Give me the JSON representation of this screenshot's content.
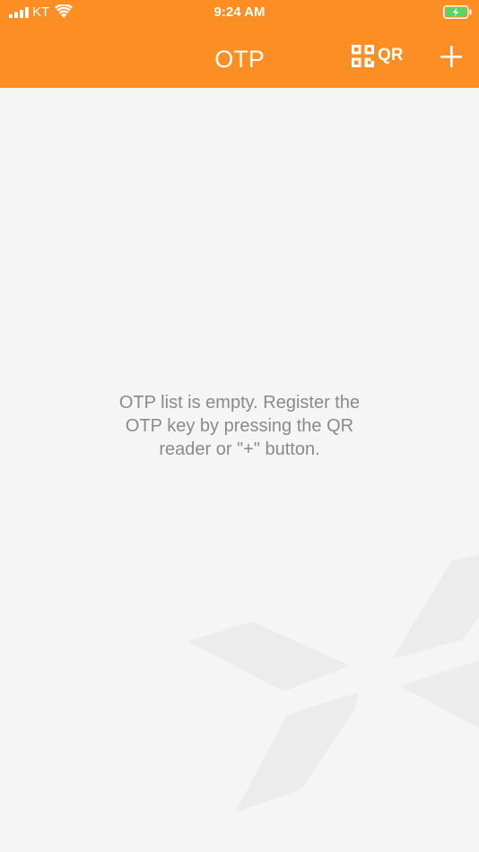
{
  "status_bar": {
    "carrier": "KT",
    "time": "9:24 AM"
  },
  "nav": {
    "title": "OTP",
    "qr_label": "QR"
  },
  "empty_state": {
    "message": "OTP list is empty. Register the OTP key by pressing the QR reader or \"+\" button."
  },
  "icons": {
    "signal": "signal-icon",
    "wifi": "wifi-icon",
    "battery": "battery-charging-icon",
    "qr": "qr-code-icon",
    "add": "plus-icon",
    "watermark": "logo-watermark-icon"
  },
  "colors": {
    "header": "#fc8e23",
    "background": "#f5f5f5",
    "message_text": "#8a8a8a",
    "watermark": "#ececec",
    "battery_fill": "#4cd964"
  }
}
